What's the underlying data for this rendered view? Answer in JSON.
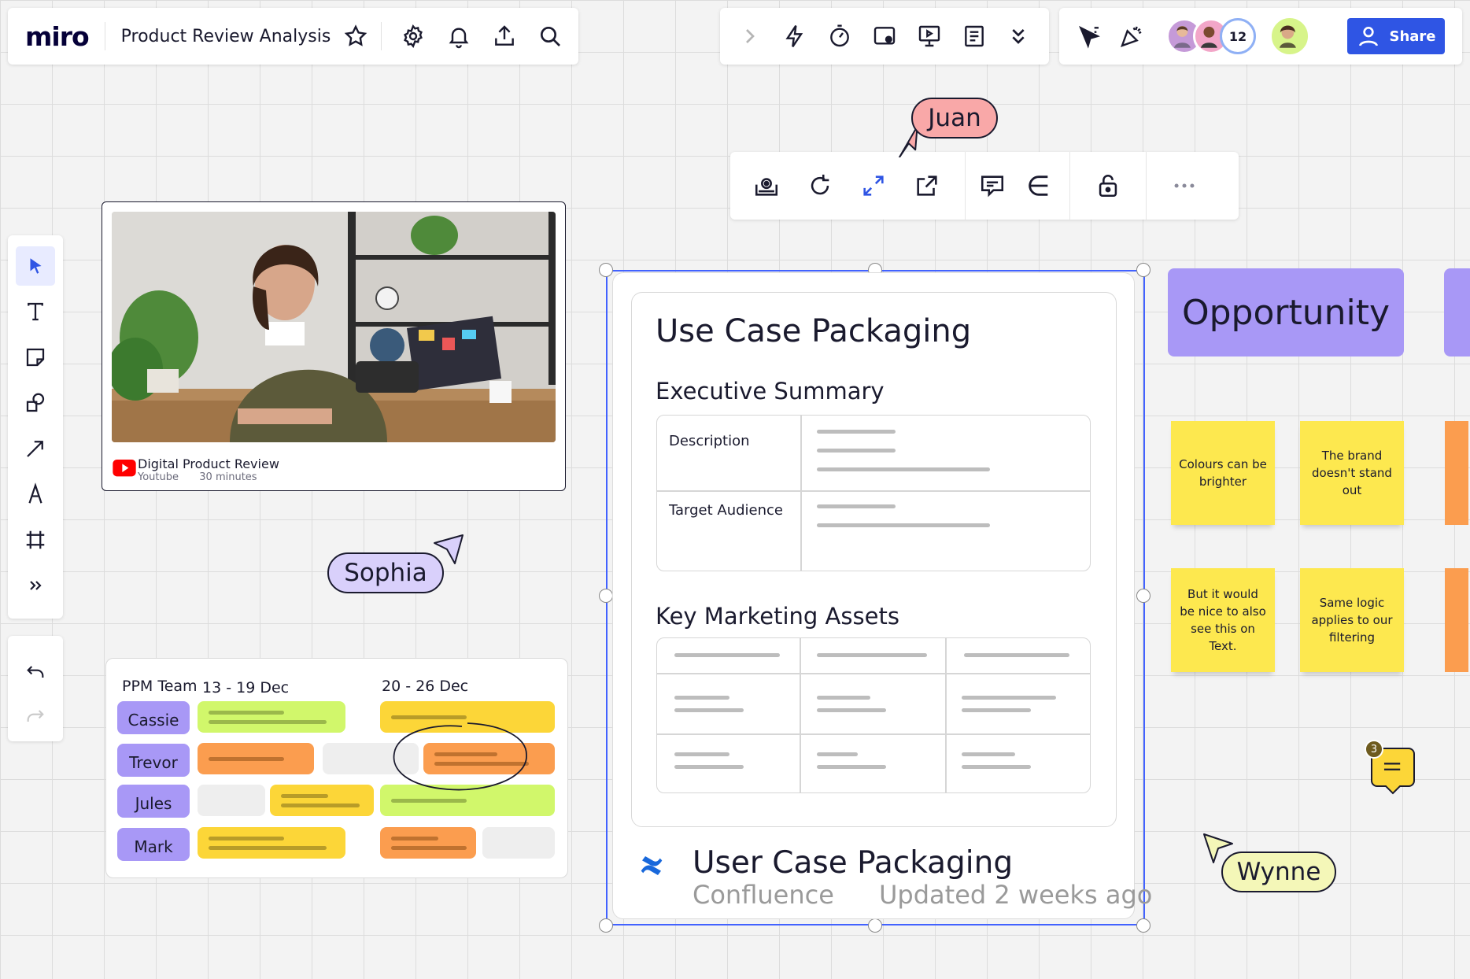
{
  "topbar": {
    "logo": "miro",
    "board_title": "Product Review Analysis",
    "icons": [
      "star-icon",
      "settings-icon",
      "bell-icon",
      "export-icon",
      "search-icon"
    ]
  },
  "toolbar_mid": {
    "icons": [
      "chevron-right-icon",
      "lightning-icon",
      "timer-icon",
      "video-chat-icon",
      "presentation-icon",
      "notes-icon",
      "chevron-double-down-icon"
    ]
  },
  "collaboration": {
    "avatar_count": "12",
    "share_label": "Share",
    "icons": [
      "pointer-icon",
      "celebrate-icon",
      "user-icon"
    ]
  },
  "left_toolbar": {
    "tools": [
      "select-icon",
      "text-icon",
      "sticky-note-icon",
      "shapes-icon",
      "arrow-icon",
      "pen-icon",
      "frame-icon",
      "more-tools-icon"
    ],
    "undo_redo": [
      "undo-icon",
      "redo-icon"
    ]
  },
  "video_card": {
    "title": "Digital Product Review",
    "source": "Youtube",
    "duration": "30 minutes"
  },
  "ppm": {
    "team": "PPM Team",
    "week1": "13 - 19 Dec",
    "week2": "20 - 26 Dec",
    "people": [
      "Cassie",
      "Trevor",
      "Jules",
      "Mark"
    ]
  },
  "context_toolbar": {
    "icons": [
      "preview-icon",
      "refresh-icon",
      "expand-icon",
      "open-external-icon",
      "comment-icon",
      "jira-icon",
      "lock-icon",
      "more-icon"
    ]
  },
  "confluence_doc": {
    "title": "Use Case Packaging",
    "section1": "Executive Summary",
    "row1_label": "Description",
    "row2_label": "Target Audience",
    "section2": "Key Marketing Assets",
    "card_title": "User Case Packaging",
    "card_source": "Confluence",
    "card_updated": "Updated 2 weeks ago"
  },
  "opportunity": {
    "label": "Opportunity"
  },
  "stickies": [
    "Colours can be brighter",
    "The brand doesn't stand out",
    "But it would be nice to also see this on Text.",
    "Same logic applies to our filtering"
  ],
  "comment": {
    "count": "3"
  },
  "cursors": {
    "juan": "Juan",
    "sophia": "Sophia",
    "wynne": "Wynne"
  },
  "colors": {
    "accent": "#2f55e4",
    "selection": "#4262ff",
    "purple": "#a898f6",
    "sticky_yellow": "#fde84f",
    "juan": "#f9a8a8",
    "sophia": "#d9d0fb",
    "wynne": "#f4f7b8"
  }
}
